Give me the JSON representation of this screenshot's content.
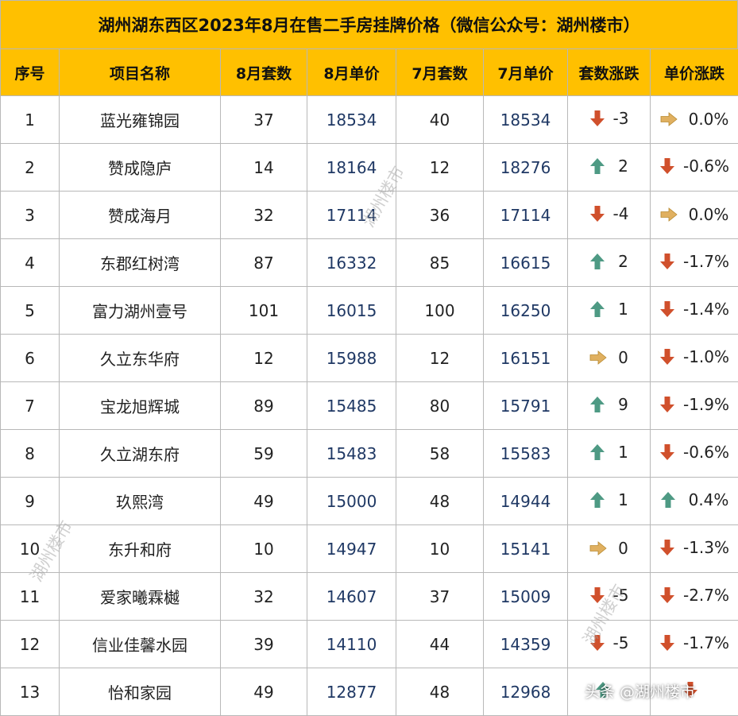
{
  "title": "湖州湖东西区2023年8月在售二手房挂牌价格（微信公众号：湖州楼市）",
  "columns": [
    "序号",
    "项目名称",
    "8月套数",
    "8月单价",
    "7月套数",
    "7月单价",
    "套数涨跌",
    "单价涨跌"
  ],
  "rows": [
    {
      "no": "1",
      "name": "蓝光雍锦园",
      "aug_count": "37",
      "aug_price": "18534",
      "jul_count": "40",
      "jul_price": "18534",
      "count_dir": "down",
      "count_change": "-3",
      "price_dir": "flat",
      "price_change": "0.0%"
    },
    {
      "no": "2",
      "name": "赞成隐庐",
      "aug_count": "14",
      "aug_price": "18164",
      "jul_count": "12",
      "jul_price": "18276",
      "count_dir": "up",
      "count_change": "2",
      "price_dir": "down",
      "price_change": "-0.6%"
    },
    {
      "no": "3",
      "name": "赞成海月",
      "aug_count": "32",
      "aug_price": "17114",
      "jul_count": "36",
      "jul_price": "17114",
      "count_dir": "down",
      "count_change": "-4",
      "price_dir": "flat",
      "price_change": "0.0%"
    },
    {
      "no": "4",
      "name": "东郡红树湾",
      "aug_count": "87",
      "aug_price": "16332",
      "jul_count": "85",
      "jul_price": "16615",
      "count_dir": "up",
      "count_change": "2",
      "price_dir": "down",
      "price_change": "-1.7%"
    },
    {
      "no": "5",
      "name": "富力湖州壹号",
      "aug_count": "101",
      "aug_price": "16015",
      "jul_count": "100",
      "jul_price": "16250",
      "count_dir": "up",
      "count_change": "1",
      "price_dir": "down",
      "price_change": "-1.4%"
    },
    {
      "no": "6",
      "name": "久立东华府",
      "aug_count": "12",
      "aug_price": "15988",
      "jul_count": "12",
      "jul_price": "16151",
      "count_dir": "flat",
      "count_change": "0",
      "price_dir": "down",
      "price_change": "-1.0%"
    },
    {
      "no": "7",
      "name": "宝龙旭辉城",
      "aug_count": "89",
      "aug_price": "15485",
      "jul_count": "80",
      "jul_price": "15791",
      "count_dir": "up",
      "count_change": "9",
      "price_dir": "down",
      "price_change": "-1.9%"
    },
    {
      "no": "8",
      "name": "久立湖东府",
      "aug_count": "59",
      "aug_price": "15483",
      "jul_count": "58",
      "jul_price": "15583",
      "count_dir": "up",
      "count_change": "1",
      "price_dir": "down",
      "price_change": "-0.6%"
    },
    {
      "no": "9",
      "name": "玖熙湾",
      "aug_count": "49",
      "aug_price": "15000",
      "jul_count": "48",
      "jul_price": "14944",
      "count_dir": "up",
      "count_change": "1",
      "price_dir": "up",
      "price_change": "0.4%"
    },
    {
      "no": "10",
      "name": "东升和府",
      "aug_count": "10",
      "aug_price": "14947",
      "jul_count": "10",
      "jul_price": "15141",
      "count_dir": "flat",
      "count_change": "0",
      "price_dir": "down",
      "price_change": "-1.3%"
    },
    {
      "no": "11",
      "name": "爱家曦霖樾",
      "aug_count": "32",
      "aug_price": "14607",
      "jul_count": "37",
      "jul_price": "15009",
      "count_dir": "down",
      "count_change": "-5",
      "price_dir": "down",
      "price_change": "-2.7%"
    },
    {
      "no": "12",
      "name": "信业佳馨水园",
      "aug_count": "39",
      "aug_price": "14110",
      "jul_count": "44",
      "jul_price": "14359",
      "count_dir": "down",
      "count_change": "-5",
      "price_dir": "down",
      "price_change": "-1.7%"
    },
    {
      "no": "13",
      "name": "怡和家园",
      "aug_count": "49",
      "aug_price": "12877",
      "jul_count": "48",
      "jul_price": "12968",
      "count_dir": "up",
      "count_change": "",
      "price_dir": "down",
      "price_change": ""
    }
  ],
  "watermark_text": "湖州楼市",
  "footer_watermark": "头条 @湖州楼市",
  "colors": {
    "header_bg": "#ffc000",
    "arrow_up": "#4e9a84",
    "arrow_down": "#d0502c",
    "arrow_flat": "#e0b060",
    "price_text": "#1f3864"
  }
}
